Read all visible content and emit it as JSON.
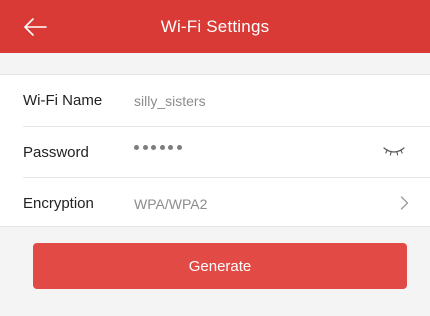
{
  "header": {
    "title": "Wi-Fi Settings",
    "back_icon": "arrow-left-icon",
    "background": "#d93a35"
  },
  "form": {
    "wifi_name": {
      "label": "Wi-Fi Name",
      "value": "silly_sisters"
    },
    "password": {
      "label": "Password",
      "dots": 6,
      "toggle_icon": "eye-closed-icon"
    },
    "encryption": {
      "label": "Encryption",
      "value": "WPA/WPA2",
      "chevron_icon": "chevron-right-icon"
    }
  },
  "generate": {
    "label": "Generate",
    "background": "#e24a45"
  }
}
